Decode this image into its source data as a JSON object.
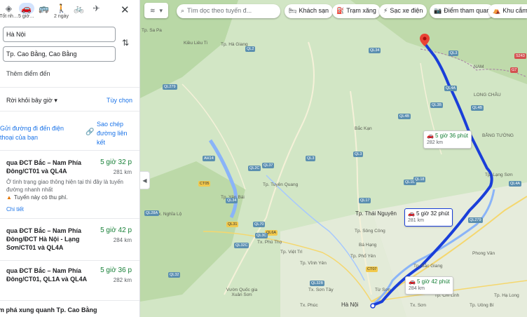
{
  "modes": [
    {
      "label": "Tốt nh…",
      "icon": "diamond-directions-icon",
      "active": false
    },
    {
      "label": "5 giờ…",
      "icon": "car-icon",
      "active": true
    },
    {
      "label": "",
      "icon": "bus-icon",
      "active": false
    },
    {
      "label": "2 ngày",
      "icon": "walk-icon",
      "active": false
    },
    {
      "label": "",
      "icon": "bicycle-icon",
      "active": false
    },
    {
      "label": "",
      "icon": "plane-icon",
      "active": false
    }
  ],
  "origin": "Hà Nội",
  "destination": "Tp. Cao Bằng, Cao Bằng",
  "add_destination": "Thêm điểm đến",
  "depart_label": "Rời khỏi bây giờ",
  "options_label": "Tùy chọn",
  "send_to_phone": "Gửi đường đi đến điện thoại của bạn",
  "copy_link": "Sao chép đường liên kết",
  "routes": [
    {
      "name": "qua ĐCT Bắc – Nam Phía Đông/CT01 và QL4A",
      "time": "5 giờ 32 p",
      "distance": "281 km",
      "desc": "Ở tình trạng giao thông hiện tại thì đây là tuyến đường nhanh nhất",
      "toll": "Tuyến này có thu phí.",
      "details": "Chi tiết"
    },
    {
      "name": "qua ĐCT Bắc – Nam Phía Đông/ĐCT Hà Nội - Lạng Sơn/CT01 và QL4A",
      "time": "5 giờ 42 p",
      "distance": "284 km"
    },
    {
      "name": "qua ĐCT Bắc – Nam Phía Đông/CT01, QL1A và QL4A",
      "time": "5 giờ 36 p",
      "distance": "282 km"
    }
  ],
  "explore": "m phá xung quanh Tp. Cao Bằng",
  "map": {
    "search_placeholder": "Tìm dọc theo tuyến đ...",
    "chips": [
      {
        "label": "Khách sạn",
        "icon": "bed-icon"
      },
      {
        "label": "Trạm xăng",
        "icon": "fuel-icon"
      },
      {
        "label": "Sạc xe điện",
        "icon": "ev-charger-icon"
      },
      {
        "label": "Điểm tham quan",
        "icon": "camera-icon"
      },
      {
        "label": "Khu cắm",
        "icon": "tent-icon"
      }
    ],
    "route_boxes": [
      {
        "time": "5 giờ 36 phút",
        "distance": "282 km"
      },
      {
        "time": "5 giờ 32 phút",
        "distance": "281 km"
      },
      {
        "time": "5 giờ 42 phút",
        "distance": "284 km"
      }
    ],
    "places": [
      "Tp. Hà Giang",
      "Kiều Liêu Ti",
      "Bắc Kạn",
      "Tp. Tuyên Quang",
      "Tp. Yên Bái",
      "Tp. Thái Nguyên",
      "Tp. Lạng Sơn",
      "Tp. Bắc Giang",
      "Hà Nội",
      "Tp. Việt Trì",
      "Tx. Nghĩa Lộ",
      "Tx. Phú Thọ",
      "Tp. Vĩnh Yên",
      "Tp. Sông Công",
      "Bá Hạng",
      "Tp. Phổ Yên",
      "Vườn Quốc gia Xuân Sơn",
      "Tx. Sơn Tây",
      "Từ Sơn",
      "Phong Vân",
      "Tp. Hạ Long",
      "Tp. Uông Bí",
      "Tp. Chí Linh",
      "Tx. Sơn",
      "NAM",
      "LONG CHÂU",
      "BẰNG TƯỜNG",
      "Tx. Phúc",
      "Tp. Sa Pa"
    ],
    "shields": [
      "QL34",
      "QL3",
      "QL4A",
      "QL3B",
      "QL279",
      "QL2",
      "QL3",
      "QL2C",
      "CT05",
      "QL37",
      "QL4B",
      "QL1B",
      "QL18",
      "QL4A",
      "QL279",
      "QL17",
      "CT07",
      "QL3",
      "AH14",
      "QL32",
      "QL70",
      "QL32C",
      "QL31",
      "QL4B",
      "G7",
      "QL6A",
      "QL34",
      "QL3C",
      "S243",
      "QL28A",
      "QL32B"
    ]
  }
}
